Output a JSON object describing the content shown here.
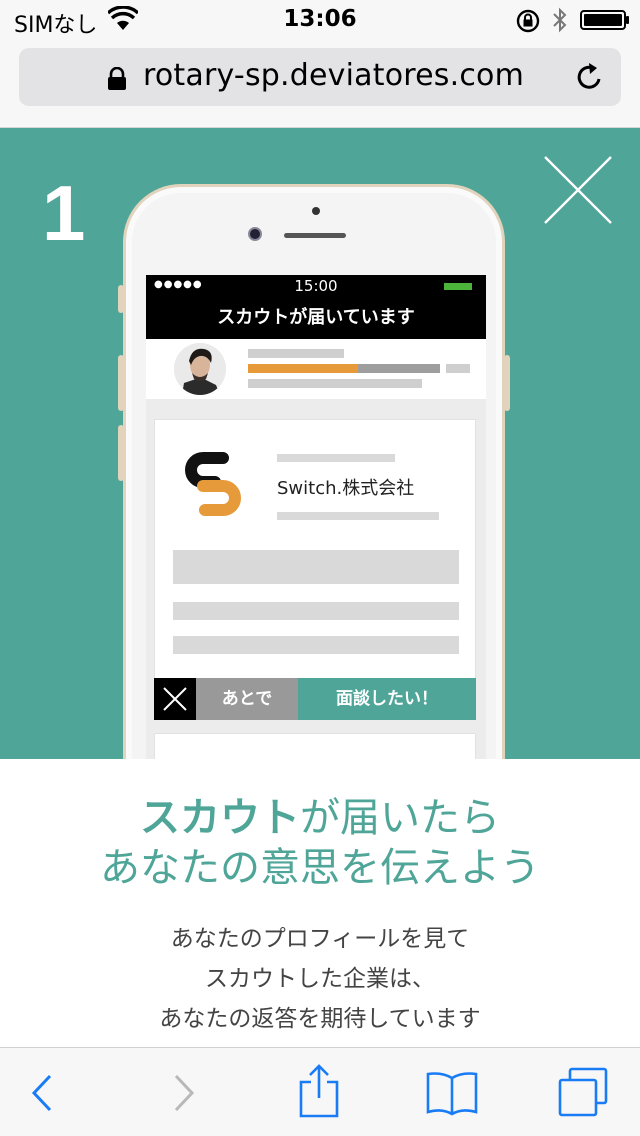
{
  "status_bar": {
    "carrier": "SIMなし",
    "time": "13:06"
  },
  "browser": {
    "url": "rotary-sp.deviatores.com"
  },
  "hero": {
    "step_number": "1",
    "background_color": "#4fa597",
    "phone_mock": {
      "status_time": "15:00",
      "status_dots": "●●●●●",
      "title": "スカウトが届いています",
      "company_name": "Switch.株式会社",
      "later_label": "あとで",
      "meet_label": "面談したい！"
    }
  },
  "content": {
    "headline_emphasis": "スカウト",
    "headline_rest_line1": "が届いたら",
    "headline_line2": "あなたの意思を伝えよう",
    "desc_line1": "あなたのプロフィールを見て",
    "desc_line2": "スカウトした企業は、",
    "desc_line3": "あなたの返答を期待しています"
  },
  "colors": {
    "accent_teal": "#4fa597",
    "orange": "#e69a39",
    "ios_blue": "#1a7cf5"
  }
}
